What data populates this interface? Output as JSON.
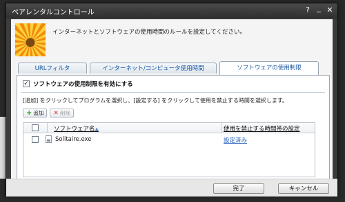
{
  "window": {
    "title": "ペアレンタルコントロール",
    "help": "?",
    "minimize": "_",
    "close": "✕"
  },
  "header": {
    "intro": "インターネットとソフトウェアの使用時間のルールを設定してください。"
  },
  "tabs": [
    {
      "label": "URLフィルタ",
      "active": false
    },
    {
      "label": "インターネット/コンピュータ使用時間",
      "active": false
    },
    {
      "label": "ソフトウェアの使用制限",
      "active": true
    }
  ],
  "panel": {
    "enable_label": "ソフトウェアの使用制限を有効にする",
    "enable_checked": true,
    "instruction": "[追加] をクリックしてプログラムを選択し、[設定する] をクリックして使用を禁止する時間を選択します。",
    "add_label": "追加",
    "delete_label": "削除",
    "table": {
      "columns": [
        "ソフトウェア名",
        "使用を禁止する時間帯の設定"
      ],
      "sort_indicator": "▲",
      "rows": [
        {
          "name": "Solitaire.exe",
          "setting": "設定済み"
        }
      ]
    }
  },
  "footer": {
    "ok_label": "完了",
    "cancel_label": "キャンセル"
  }
}
